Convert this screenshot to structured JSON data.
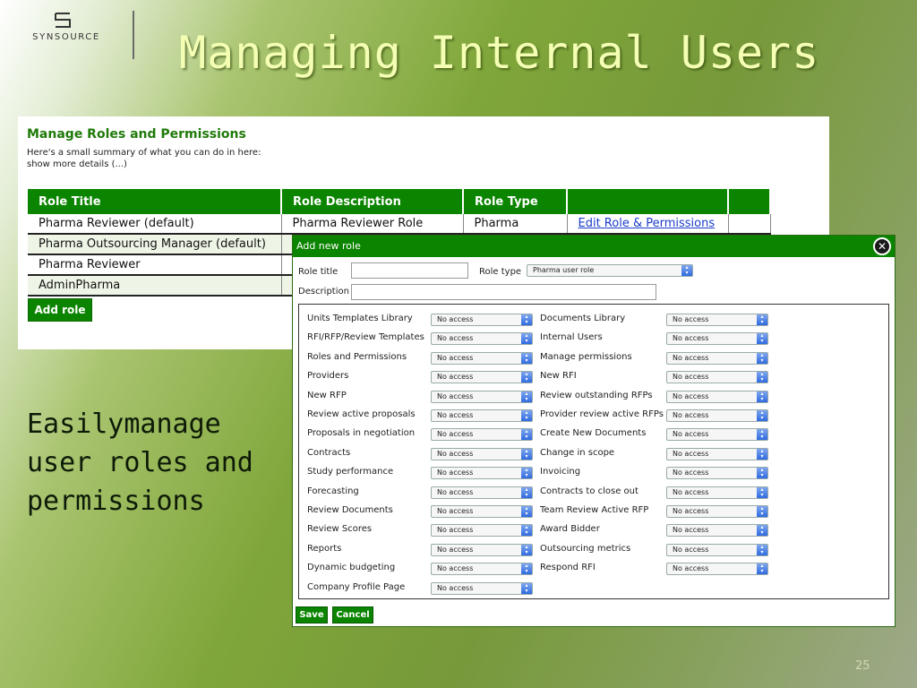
{
  "header": {
    "logo_text": "SYNSOURCE",
    "title": "Managing Internal Users"
  },
  "tagline": [
    "Easilymanage",
    "user roles and",
    "permissions"
  ],
  "slide_number": "25",
  "roles_panel": {
    "title": "Manage Roles and Permissions",
    "intro_line1": "Here's a small summary of what you can do in here:",
    "intro_line2": "show more details (...)",
    "columns": [
      "Role Title",
      "Role Description",
      "Role Type",
      ""
    ],
    "rows": [
      {
        "title": "Pharma Reviewer (default)",
        "description": "Pharma Reviewer Role",
        "type": "Pharma",
        "action": "Edit Role & Permissions"
      },
      {
        "title": "Pharma Outsourcing Manager (default)",
        "description": "",
        "type": "",
        "action": ""
      },
      {
        "title": "Pharma Reviewer",
        "description": "",
        "type": "",
        "action": ""
      },
      {
        "title": "AdminPharma",
        "description": "",
        "type": "",
        "action": ""
      }
    ],
    "add_role_label": "Add role"
  },
  "dialog": {
    "title": "Add new role",
    "close_glyph": "✕",
    "role_title_label": "Role title",
    "role_title_value": "",
    "role_type_label": "Role type",
    "role_type_value": "Pharma user role",
    "description_label": "Description",
    "description_value": "",
    "permissions_left": [
      {
        "label": "Units Templates Library",
        "value": "No access"
      },
      {
        "label": "RFI/RFP/Review Templates",
        "value": "No access"
      },
      {
        "label": "Roles and Permissions",
        "value": "No access"
      },
      {
        "label": "Providers",
        "value": "No access"
      },
      {
        "label": "New RFP",
        "value": "No access"
      },
      {
        "label": "Review active proposals",
        "value": "No access"
      },
      {
        "label": "Proposals in negotiation",
        "value": "No access"
      },
      {
        "label": "Contracts",
        "value": "No access"
      },
      {
        "label": "Study performance",
        "value": "No access"
      },
      {
        "label": "Forecasting",
        "value": "No access"
      },
      {
        "label": "Review Documents",
        "value": "No access"
      },
      {
        "label": "Review Scores",
        "value": "No access"
      },
      {
        "label": "Reports",
        "value": "No access"
      },
      {
        "label": "Dynamic budgeting",
        "value": "No access"
      },
      {
        "label": "Company Profile Page",
        "value": "No access"
      }
    ],
    "permissions_right": [
      {
        "label": "Documents Library",
        "value": "No access"
      },
      {
        "label": "Internal Users",
        "value": "No access"
      },
      {
        "label": "Manage permissions",
        "value": "No access"
      },
      {
        "label": "New RFI",
        "value": "No access"
      },
      {
        "label": "Review outstanding RFPs",
        "value": "No access"
      },
      {
        "label": "Provider review active RFPs",
        "value": "No access"
      },
      {
        "label": "Create New Documents",
        "value": "No access"
      },
      {
        "label": "Change in scope",
        "value": "No access"
      },
      {
        "label": "Invoicing",
        "value": "No access"
      },
      {
        "label": "Contracts to close out",
        "value": "No access"
      },
      {
        "label": "Team Review Active RFP",
        "value": "No access"
      },
      {
        "label": "Award Bidder",
        "value": "No access"
      },
      {
        "label": "Outsourcing metrics",
        "value": "No access"
      },
      {
        "label": "Respond RFI",
        "value": "No access"
      }
    ],
    "save_label": "Save",
    "cancel_label": "Cancel"
  },
  "colors": {
    "accent_green": "#0b8400",
    "title_yellow": "#f4ffb4",
    "link_blue": "#1a3cc8"
  }
}
